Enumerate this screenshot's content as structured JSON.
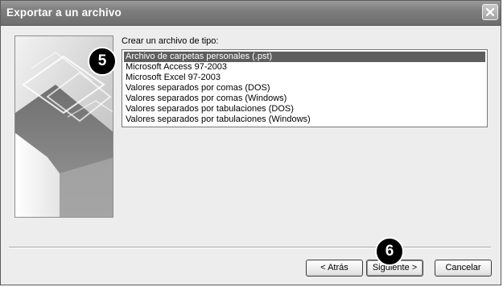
{
  "window": {
    "title": "Exportar a un archivo"
  },
  "list": {
    "caption": "Crear un archivo de tipo:",
    "items": [
      {
        "label": "Archivo de carpetas personales (.pst)",
        "selected": true
      },
      {
        "label": "Microsoft Access 97-2003",
        "selected": false
      },
      {
        "label": "Microsoft Excel 97-2003",
        "selected": false
      },
      {
        "label": "Valores separados por comas (DOS)",
        "selected": false
      },
      {
        "label": "Valores separados por comas (Windows)",
        "selected": false
      },
      {
        "label": "Valores separados por tabulaciones (DOS)",
        "selected": false
      },
      {
        "label": "Valores separados por tabulaciones (Windows)",
        "selected": false
      }
    ]
  },
  "callouts": {
    "step_list": "5",
    "step_next": "6"
  },
  "buttons": {
    "back": "< Atrás",
    "next": "Siguiente >",
    "cancel": "Cancelar"
  },
  "colors": {
    "selection": "#5e5e5e",
    "titlebar": "#7d7d7d",
    "dialog_bg": "#ededed",
    "callout": "#000000"
  }
}
